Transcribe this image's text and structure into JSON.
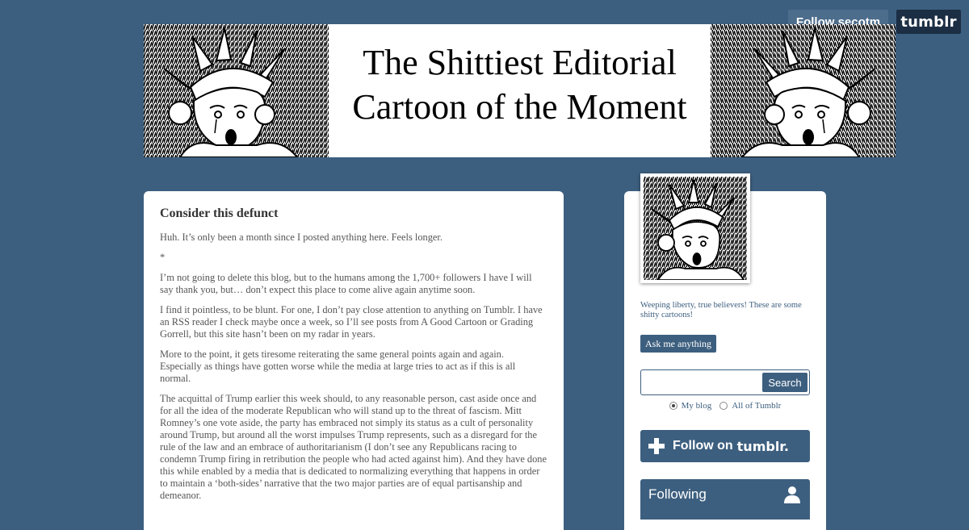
{
  "top_controls": {
    "follow_label": "Follow secotm",
    "tumblr_logo": "tumblr"
  },
  "header": {
    "title_line1": "The Shittiest Editorial",
    "title_line2": "Cartoon of the Moment"
  },
  "post": {
    "title": "Consider this defunct",
    "paragraphs": [
      "Huh. It’s only been a month since I posted anything here. Feels longer.",
      "*",
      "I’m not going to delete this blog, but to the humans among the 1,700+ followers I have I will say thank you, but… don’t expect this place to come alive again anytime soon.",
      "I find it pointless, to be blunt. For one, I don’t pay close attention to anything on Tumblr. I have an RSS reader I check maybe once a week, so I’ll see posts from A Good Cartoon or Grading Gorrell, but this site hasn’t been on my radar in years.",
      "More to the point, it gets tiresome reiterating the same general points again and again. Especially as things have gotten worse while the media at large tries to act as if this is all normal.",
      "The acquittal of Trump earlier this week should, to any reasonable person, cast aside once and for all the idea of the moderate Republican who will stand up to the threat of fascism. Mitt Romney’s one vote aside, the party has embraced not simply its status as a cult of personality around Trump, but around all the worst impulses Trump represents, such as a disregard for the rule of the law and an embrace of authoritarianism (I don’t see any Republicans racing to condemn Trump firing in retribution the people who had acted against him). And they have done this while enabled by a media that is dedicated to normalizing everything that happens in order to maintain a ‘both-sides’ narrative that the two major parties are of equal partisanship and demeanor."
    ]
  },
  "sidebar": {
    "description": "Weeping liberty, true believers! These are some shitty cartoons!",
    "ask_label": "Ask me anything",
    "search": {
      "value": "",
      "button_label": "Search"
    },
    "search_scope": {
      "options": [
        "My blog",
        "All of Tumblr"
      ],
      "selected": "My blog"
    },
    "follow_widget": {
      "follow_text": "Follow on",
      "tumblr_word": "tumblr."
    },
    "following_label": "Following"
  },
  "colors": {
    "background": "#3d5f7f",
    "accent": "#3d5f7f",
    "tumblr_dark": "#1b2e44"
  },
  "icons": [
    "plus-icon",
    "person-icon",
    "statue-of-liberty-illustration"
  ]
}
